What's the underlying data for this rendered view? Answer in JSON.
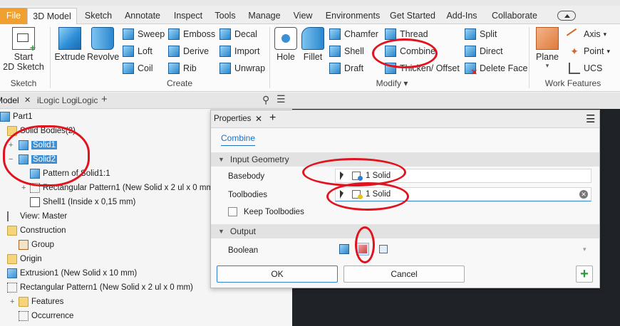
{
  "ribbon_tabs": [
    "File",
    "3D Model",
    "Sketch",
    "Annotate",
    "Inspect",
    "Tools",
    "Manage",
    "View",
    "Environments",
    "Get Started",
    "Add-Ins",
    "Collaborate"
  ],
  "ribbon": {
    "start_sketch": [
      "Start",
      "2D Sketch"
    ],
    "extrude": "Extrude",
    "revolve": "Revolve",
    "sweep": "Sweep",
    "loft": "Loft",
    "coil": "Coil",
    "emboss": "Emboss",
    "derive": "Derive",
    "rib": "Rib",
    "decal": "Decal",
    "import": "Import",
    "unwrap": "Unwrap",
    "hole": "Hole",
    "fillet": "Fillet",
    "chamfer": "Chamfer",
    "shell": "Shell",
    "draft": "Draft",
    "thread": "Thread",
    "combine": "Combine",
    "thicken": "Thicken/ Offset",
    "split": "Split",
    "direct": "Direct",
    "delete_face": "Delete Face",
    "plane": "Plane",
    "axis": "Axis",
    "point": "Point",
    "ucs": "UCS",
    "groups": {
      "sketch": "Sketch",
      "create": "Create",
      "modify": "Modify",
      "work_features": "Work Features"
    }
  },
  "browser": {
    "tabs": [
      "Model",
      "iLogic Log",
      "iLogic"
    ],
    "items": [
      "Part1",
      "Solid Bodies(2)",
      "Solid1",
      "Solid2",
      "Pattern of Solid1:1",
      "Rectangular Pattern1 (New Solid x 2 ul x 0 mm)",
      "Shell1 (Inside x 0,15 mm)",
      "View: Master",
      "Construction",
      "Group",
      "Origin",
      "Extrusion1 (New Solid x 10 mm)",
      "Rectangular Pattern1 (New Solid x 2 ul x 0 mm)",
      "Features",
      "Occurrence"
    ]
  },
  "properties": {
    "title": "Properties",
    "command_tab": "Combine",
    "input_geometry": "Input Geometry",
    "basebody_label": "Basebody",
    "basebody_value": "1 Solid",
    "toolbodies_label": "Toolbodies",
    "toolbodies_value": "1 Solid",
    "keep_toolbodies": "Keep Toolbodies",
    "output": "Output",
    "boolean_label": "Boolean",
    "ok": "OK",
    "cancel": "Cancel"
  },
  "colors": {
    "file_tab": "#f0a030",
    "selection": "#3d8fd6",
    "annotation_red": "#e0141e",
    "viewport_bg": "#1f2328",
    "ok_plus": "#2a9a3a"
  }
}
